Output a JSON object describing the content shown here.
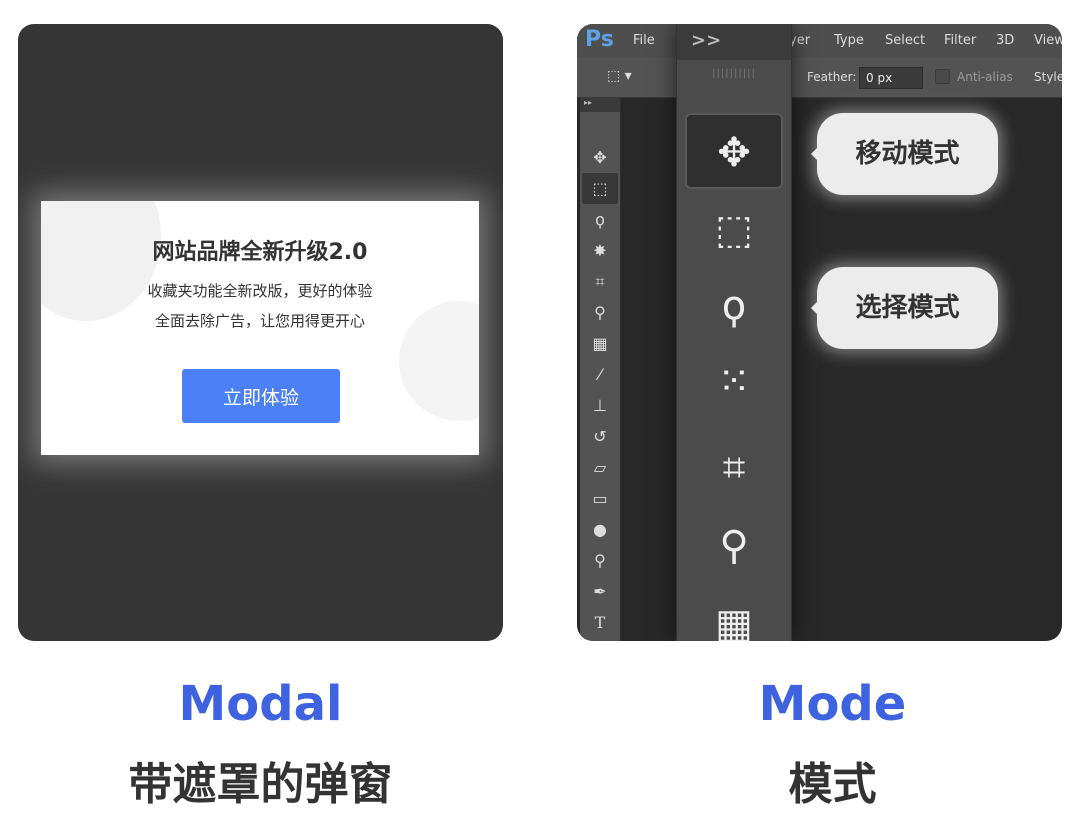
{
  "modal_card": {
    "modal_title": "网站品牌全新升级2.0",
    "modal_line1": "收藏夹功能全新改版，更好的体验",
    "modal_line2": "全面去除广告，让您用得更开心",
    "button_label": "立即体验",
    "button_color": "#4c80f6"
  },
  "mode_card": {
    "logo": "Ps",
    "menu": [
      "File",
      "yer",
      "Type",
      "Select",
      "Filter",
      "3D",
      "View"
    ],
    "feather_label": "Feather:",
    "feather_value": "0 px",
    "anti_alias_label": "Anti-alias",
    "style_label": "Style",
    "panel_collapse": ">>",
    "tools": [
      "move-icon",
      "marquee-icon",
      "lasso-icon",
      "quick-selection-icon",
      "crop-icon",
      "eyedropper-icon",
      "healing-brush-icon"
    ],
    "bubble_move": "移动模式",
    "bubble_select": "选择模式"
  },
  "captions": {
    "left_en": "Modal",
    "left_zh": "带遮罩的弹窗",
    "right_en": "Mode",
    "right_zh": "模式",
    "accent": "#3f63e0"
  }
}
